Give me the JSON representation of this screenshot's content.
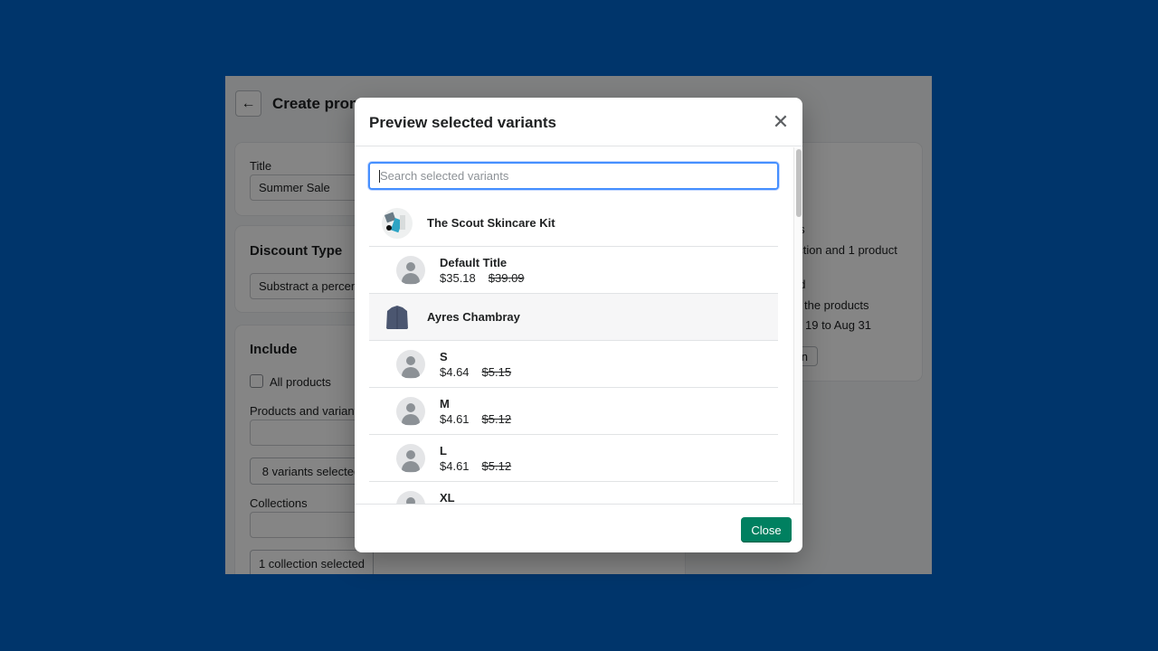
{
  "page": {
    "title": "Create prom",
    "title_card": {
      "label": "Title",
      "value": "Summer Sale"
    },
    "discount_card": {
      "heading": "Discount Type",
      "value": "Substract a percenta"
    },
    "include_card": {
      "heading": "Include",
      "all_products": "All products",
      "products_label": "Products and variants",
      "variants_button": "8 variants selected",
      "collections_label": "Collections",
      "collections_button": "1 collection selected"
    },
    "summary": [
      "cts",
      "ection and 1 product",
      "ed",
      "the products",
      "19 to Aug 31"
    ],
    "summary_button": "n"
  },
  "modal": {
    "title": "Preview selected variants",
    "search_placeholder": "Search selected variants",
    "close_label": "Close",
    "products": [
      {
        "name": "The Scout Skincare Kit",
        "variants": [
          {
            "name": "Default Title",
            "price": "$35.18",
            "compare_price": "$39.09"
          }
        ]
      },
      {
        "name": "Ayres Chambray",
        "variants": [
          {
            "name": "S",
            "price": "$4.64",
            "compare_price": "$5.15"
          },
          {
            "name": "M",
            "price": "$4.61",
            "compare_price": "$5.12"
          },
          {
            "name": "L",
            "price": "$4.61",
            "compare_price": "$5.12"
          },
          {
            "name": "XL",
            "price": "",
            "compare_price": ""
          }
        ]
      }
    ]
  },
  "colors": {
    "background": "#00356b",
    "primary": "#008060",
    "focus": "#458fff"
  }
}
